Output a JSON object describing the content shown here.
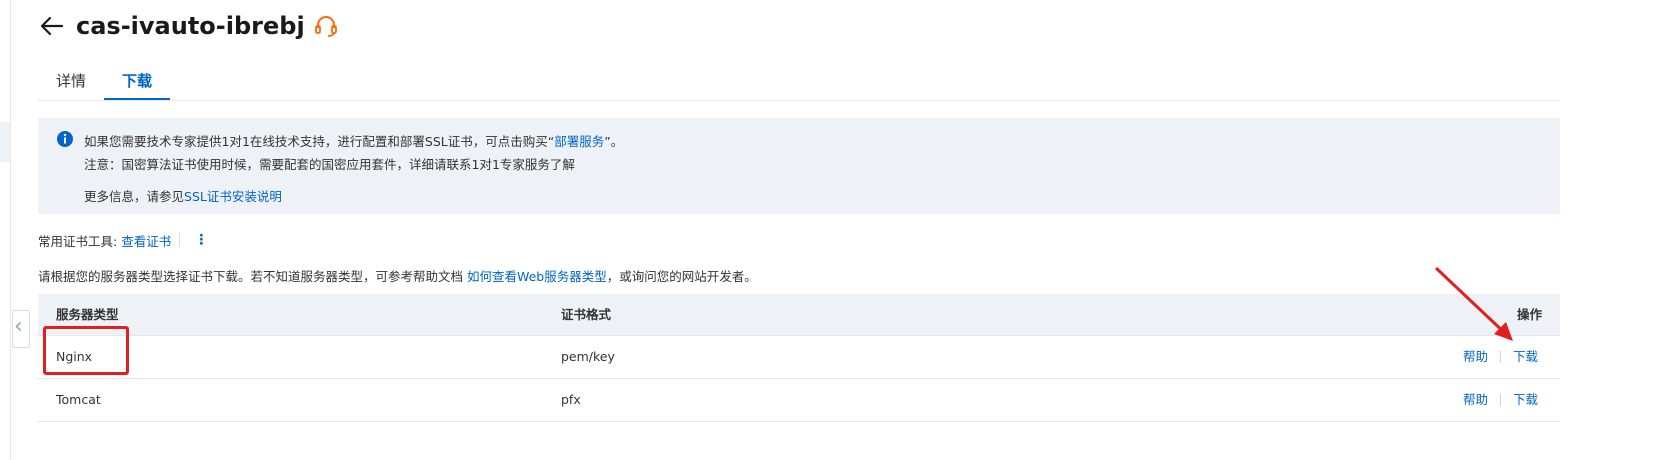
{
  "header": {
    "title": "cas-ivauto-ibrebj"
  },
  "tabs": [
    {
      "label": "详情",
      "active": false
    },
    {
      "label": "下载",
      "active": true
    }
  ],
  "notice": {
    "line1_prefix": "如果您需要技术专家提供1对1在线技术支持，进行配置和部署SSL证书，可点击购买“",
    "line1_link": "部署服务",
    "line1_suffix": "”。",
    "line2": "注意：国密算法证书使用时候，需要配套的国密应用套件，详细请联系1对1专家服务了解",
    "line3_prefix": "更多信息，请参见",
    "line3_link": "SSL证书安装说明"
  },
  "tools": {
    "label": "常用证书工具:",
    "link": "查看证书",
    "more": "⋮"
  },
  "guide": {
    "prefix": "请根据您的服务器类型选择证书下载。若不知道服务器类型，可参考帮助文档 ",
    "link": "如何查看Web服务器类型",
    "suffix": "，或询问您的网站开发者。"
  },
  "table": {
    "headers": {
      "server_type": "服务器类型",
      "format": "证书格式",
      "action": "操作"
    },
    "rows": [
      {
        "server": "Nginx",
        "format": "pem/key",
        "help": "帮助",
        "download": "下载"
      },
      {
        "server": "Tomcat",
        "format": "pfx",
        "help": "帮助",
        "download": "下载"
      }
    ]
  },
  "icons": {
    "back": "arrow-left-icon",
    "support": "headset-icon",
    "info": "info-icon",
    "collapse": "chevron-left-icon"
  },
  "colors": {
    "link": "#0064c8",
    "highlight": "#e02020",
    "support_icon": "#ff6a00",
    "notice_bg": "#eef1f6"
  }
}
